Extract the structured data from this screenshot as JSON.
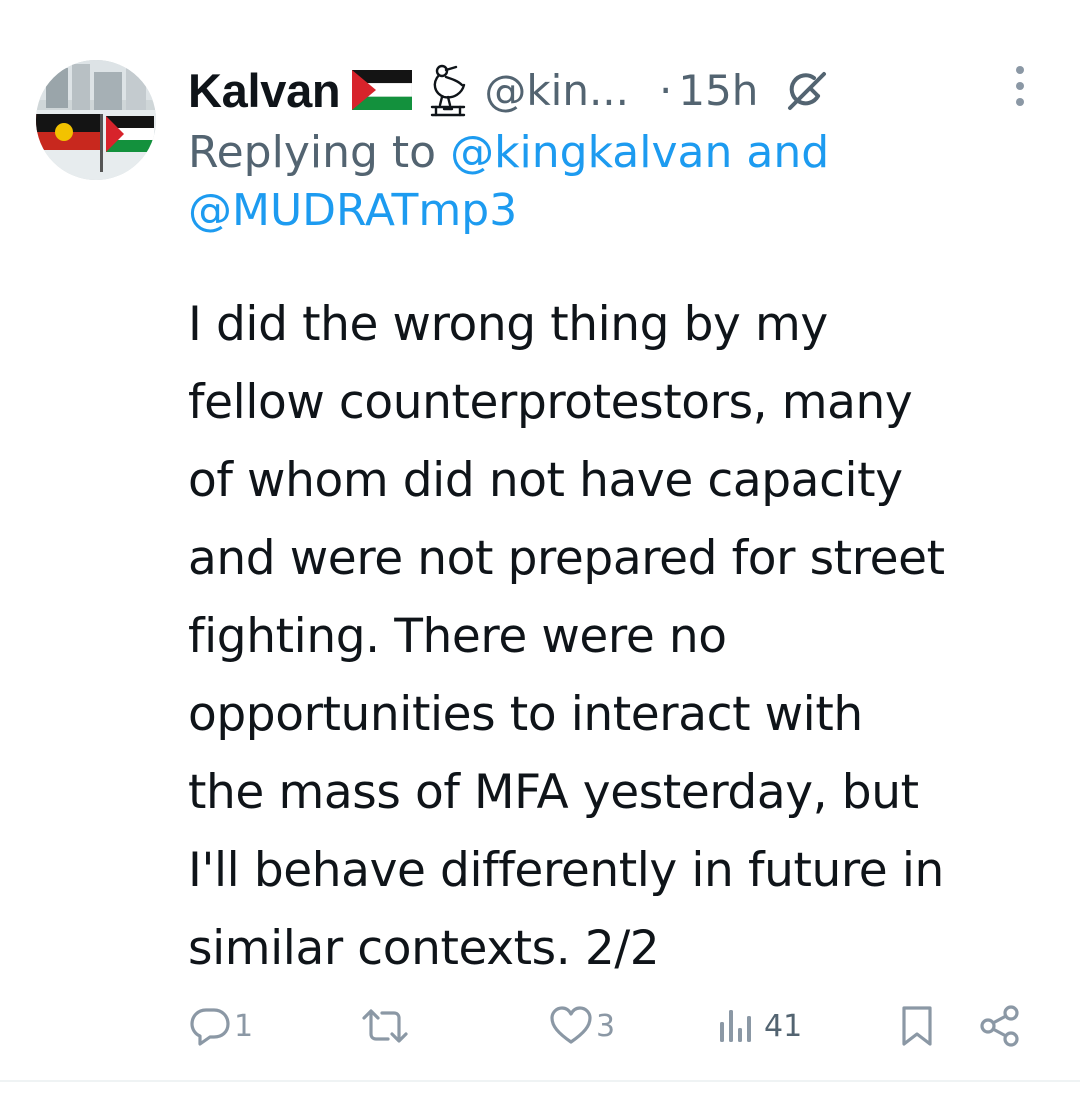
{
  "tweet": {
    "display_name": "Kalvan",
    "handle": "@kin...",
    "separator": "·",
    "time": "15h",
    "reply_prefix": "Replying to",
    "reply_user_1": "@kingkalvan",
    "reply_and": "and",
    "reply_user_2": "@MUDRATmp3",
    "text": "I did the wrong thing by my\nfellow counterprotestors, many\nof whom did not have capacity\nand were not prepared for street\nfighting. There were no\nopportunities to interact with\nthe mass of MFA yesterday, but\nI'll behave differently in future in\nsimilar contexts. 2/2"
  },
  "actions": {
    "reply_count": "1",
    "retweet_count": "",
    "like_count": "3",
    "view_count": "41"
  },
  "icons": {
    "flag": "palestine-flag-icon",
    "bird": "bird-emblem-icon",
    "grok": "grok-icon",
    "more": "more-vertical-icon",
    "reply": "reply-icon",
    "retweet": "retweet-icon",
    "like": "heart-icon",
    "views": "views-icon",
    "bookmark": "bookmark-icon",
    "share": "share-icon"
  },
  "colors": {
    "text": "#0f1419",
    "muted": "#536471",
    "link": "#1d9bf0",
    "action_gray": "#8b98a5"
  }
}
